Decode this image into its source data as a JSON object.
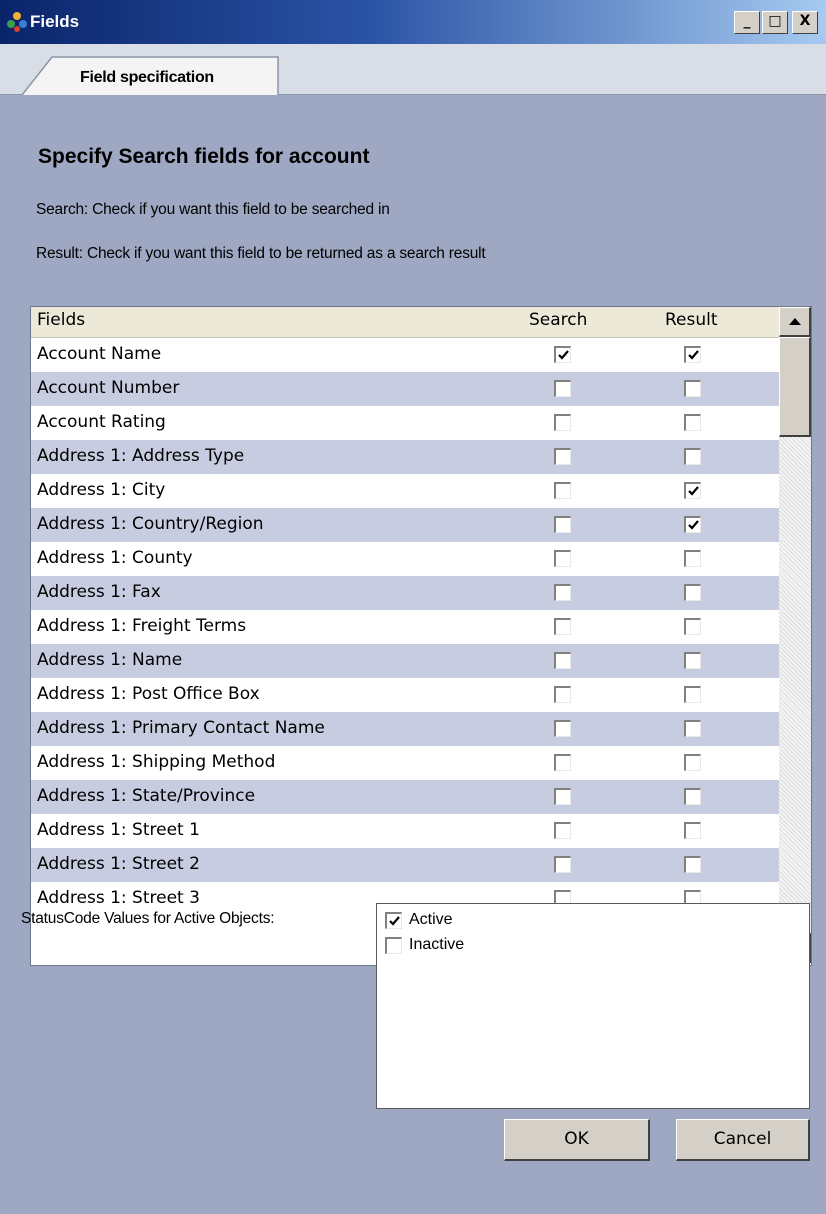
{
  "window": {
    "title": "Fields",
    "controls": {
      "minimize": "_",
      "maximize": "□",
      "close": "X"
    }
  },
  "tabs": [
    {
      "label": "Field specification",
      "active": true
    }
  ],
  "heading": "Specify Search fields for  account",
  "descriptions": {
    "search": "Search: Check if you want this field to be searched in",
    "result": "Result: Check if you want this field to be returned as a search result"
  },
  "grid": {
    "columns": {
      "fields": "Fields",
      "search": "Search",
      "result": "Result"
    },
    "rows": [
      {
        "name": "Account Name",
        "search": true,
        "result": true
      },
      {
        "name": "Account Number",
        "search": false,
        "result": false
      },
      {
        "name": "Account Rating",
        "search": false,
        "result": false
      },
      {
        "name": "Address 1: Address Type",
        "search": false,
        "result": false
      },
      {
        "name": "Address 1: City",
        "search": false,
        "result": true
      },
      {
        "name": "Address 1: Country/Region",
        "search": false,
        "result": true
      },
      {
        "name": "Address 1: County",
        "search": false,
        "result": false
      },
      {
        "name": "Address 1: Fax",
        "search": false,
        "result": false
      },
      {
        "name": "Address 1: Freight Terms",
        "search": false,
        "result": false
      },
      {
        "name": "Address 1: Name",
        "search": false,
        "result": false
      },
      {
        "name": "Address 1: Post Office Box",
        "search": false,
        "result": false
      },
      {
        "name": "Address 1: Primary Contact Name",
        "search": false,
        "result": false
      },
      {
        "name": "Address 1: Shipping Method",
        "search": false,
        "result": false
      },
      {
        "name": "Address 1: State/Province",
        "search": false,
        "result": false
      },
      {
        "name": "Address 1: Street 1",
        "search": false,
        "result": false
      },
      {
        "name": "Address 1: Street 2",
        "search": false,
        "result": false
      },
      {
        "name": "Address 1: Street 3",
        "search": false,
        "result": false
      }
    ]
  },
  "status_codes": {
    "label": "StatusCode Values for Active Objects:",
    "items": [
      {
        "label": "Active",
        "checked": true
      },
      {
        "label": "Inactive",
        "checked": false
      }
    ]
  },
  "buttons": {
    "ok": "OK",
    "cancel": "Cancel"
  },
  "colors": {
    "titlebar_start": "#0a246a",
    "titlebar_end": "#a6caf0",
    "body_bg": "#9ea8c3",
    "row_alt": "#c8cce0",
    "button_face": "#d4d0c8"
  }
}
